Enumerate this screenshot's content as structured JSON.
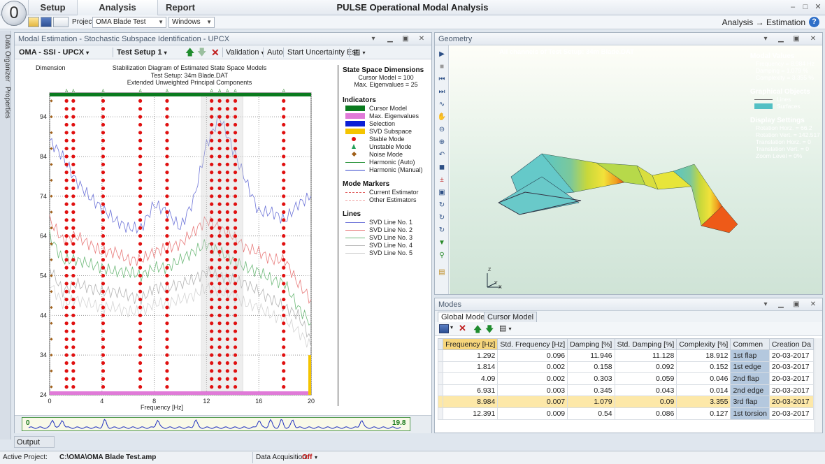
{
  "app": {
    "orb_label": "0",
    "window_title": "PULSE Operational Modal Analysis",
    "tabs": [
      "Setup",
      "Analysis",
      "Report"
    ],
    "project_label": "Project",
    "project_value": "OMA Blade Test",
    "windows_label": "Windows",
    "breadcrumb_from": "Analysis",
    "breadcrumb_arrow": "→",
    "breadcrumb_to": "Estimation",
    "help": "?",
    "ctrl_min": "–",
    "ctrl_max": "□",
    "ctrl_close": "✕"
  },
  "side_tabs": [
    "Data Organizer",
    "Properties"
  ],
  "stab_panel": {
    "title": "Modal Estimation - Stochastic Subspace Identification - UPCX",
    "method": "OMA - SSI - UPCX",
    "setup": "Test Setup 1",
    "validation": "Validation",
    "auto": "Auto",
    "uncertainty": "Start Uncertainty Est.",
    "dimension_label": "Dimension",
    "chart_title_lines": [
      "Stabilization Diagram of Estimated State Space Models",
      "Test Setup: 34m Blade.DAT",
      "Extended Unweighted Principal Components"
    ],
    "xlabel": "Frequency [Hz]",
    "overview_start": "0",
    "overview_end": "19.8",
    "legend": {
      "ssd_title": "State Space Dimensions",
      "cursor_model": "Cursor Model = 100",
      "max_eigen": "Max. Eigenvalues = 25",
      "indicators_title": "Indicators",
      "indicators": [
        {
          "label": "Cursor Model",
          "color": "#0a7a1e",
          "kind": "bar"
        },
        {
          "label": "Max. Eigenvalues",
          "color": "#e07ad8",
          "kind": "bar"
        },
        {
          "label": "Selection",
          "color": "#0b1fd6",
          "kind": "bar"
        },
        {
          "label": "SVD Subspace",
          "color": "#f4c400",
          "kind": "bar"
        },
        {
          "label": "Stable Mode",
          "color": "#e01010",
          "kind": "dot"
        },
        {
          "label": "Unstable Mode",
          "color": "#22a05a",
          "kind": "tri"
        },
        {
          "label": "Noise Mode",
          "color": "#a0601a",
          "kind": "dia"
        },
        {
          "label": "Harmonic (Auto)",
          "color": "#339944",
          "kind": "line"
        },
        {
          "label": "Harmonic (Manual)",
          "color": "#3344cc",
          "kind": "line"
        }
      ],
      "markers_title": "Mode Markers",
      "markers": [
        {
          "label": "Current Estimator",
          "color": "#e06060"
        },
        {
          "label": "Other Estimators",
          "color": "#f0a0a0"
        }
      ],
      "lines_title": "Lines",
      "lines": [
        {
          "label": "SVD Line No. 1",
          "color": "#6d74d8"
        },
        {
          "label": "SVD Line No. 2",
          "color": "#e87b7b"
        },
        {
          "label": "SVD Line No. 3",
          "color": "#6fba7a"
        },
        {
          "label": "SVD Line No. 4",
          "color": "#b4b4b4"
        },
        {
          "label": "SVD Line No. 5",
          "color": "#d4d4d4"
        }
      ]
    }
  },
  "chart_data": {
    "type": "scatter",
    "title": "Stabilization Diagram of Estimated State Space Models",
    "xlabel": "Frequency [Hz]",
    "ylabel": "Dimension",
    "xlim": [
      0,
      20
    ],
    "ylim": [
      24,
      100
    ],
    "xticks": [
      0,
      4,
      8,
      12,
      16,
      20
    ],
    "yticks": [
      24,
      34,
      44,
      54,
      64,
      74,
      84,
      94
    ],
    "stable_mode_frequencies": [
      1.29,
      1.81,
      4.09,
      6.93,
      8.98,
      12.39,
      13.0,
      13.6,
      14.2,
      17.9
    ],
    "series": [
      {
        "name": "SVD Line No. 1",
        "y": [
          88,
          84,
          78,
          74,
          71,
          68,
          66,
          66,
          72,
          70,
          66,
          73,
          87,
          94,
          86,
          78,
          70,
          70,
          68,
          72,
          74
        ]
      },
      {
        "name": "SVD Line No. 2",
        "y": [
          68,
          63,
          64,
          62,
          60,
          60,
          58,
          58,
          60,
          61,
          62,
          65,
          68,
          66,
          64,
          61,
          60,
          58,
          58,
          52,
          48
        ]
      },
      {
        "name": "SVD Line No. 3",
        "y": [
          64,
          58,
          58,
          57,
          56,
          55,
          55,
          54,
          56,
          56,
          58,
          60,
          62,
          60,
          58,
          56,
          55,
          53,
          52,
          46,
          42
        ]
      },
      {
        "name": "SVD Line No. 4",
        "y": [
          56,
          50,
          52,
          51,
          50,
          50,
          49,
          48,
          51,
          51,
          52,
          53,
          55,
          54,
          53,
          52,
          50,
          48,
          46,
          44,
          38
        ]
      },
      {
        "name": "SVD Line No. 5",
        "y": [
          52,
          47,
          48,
          47,
          46,
          46,
          45,
          45,
          47,
          47,
          48,
          49,
          51,
          50,
          49,
          47,
          46,
          44,
          43,
          40,
          36
        ]
      }
    ]
  },
  "geometry": {
    "title": "Geometry",
    "caption": "All channels of Test Setup: 34m Blade.DAT",
    "modal_values_title": "Modal Values",
    "modal_values": [
      "Frequency = 8.984 Hz",
      "Damping = 1.079 %",
      "Complexity = 3.355 %"
    ],
    "graphical_title": "Graphical Objects",
    "graphical": [
      {
        "label": "Lines",
        "color": "#707070"
      },
      {
        "label": "Surfaces",
        "color": "#53c0c4"
      }
    ],
    "display_title": "Display Settings",
    "display": [
      "Rotation Horz. = 66.2",
      "Rotation Vert. = 142.517",
      "Translation Horz. = 0",
      "Translation Vert. = 0",
      "Zoom Level = 0%"
    ],
    "axis_z": "Z",
    "axis_x": "X",
    "axis_y": "Y"
  },
  "modes": {
    "title": "Modes",
    "tabs": [
      "Global Modes",
      "Cursor Model"
    ],
    "columns": [
      "Frequency [Hz]",
      "Std. Frequency [Hz]",
      "Damping [%]",
      "Std. Damping [%]",
      "Complexity [%]",
      "Commen",
      "Creation Da"
    ],
    "rows": [
      [
        "1.292",
        "0.096",
        "11.946",
        "11.128",
        "18.912",
        "1st flap",
        "20-03-2017"
      ],
      [
        "1.814",
        "0.002",
        "0.158",
        "0.092",
        "0.152",
        "1st edge",
        "20-03-2017"
      ],
      [
        "4.09",
        "0.002",
        "0.303",
        "0.059",
        "0.046",
        "2nd flap",
        "20-03-2017"
      ],
      [
        "6.931",
        "0.003",
        "0.345",
        "0.043",
        "0.014",
        "2nd edge",
        "20-03-2017"
      ],
      [
        "8.984",
        "0.007",
        "1.079",
        "0.09",
        "3.355",
        "3rd flap",
        "20-03-2017"
      ],
      [
        "12.391",
        "0.009",
        "0.54",
        "0.086",
        "0.127",
        "1st torsion",
        "20-03-2017"
      ]
    ],
    "highlight_row": 4
  },
  "output_label": "Output",
  "status": {
    "project_label": "Active Project:",
    "project_path": "C:\\OMA\\OMA Blade Test.amp",
    "acq_label": "Data Acquisition:",
    "acq_value": "Off"
  }
}
